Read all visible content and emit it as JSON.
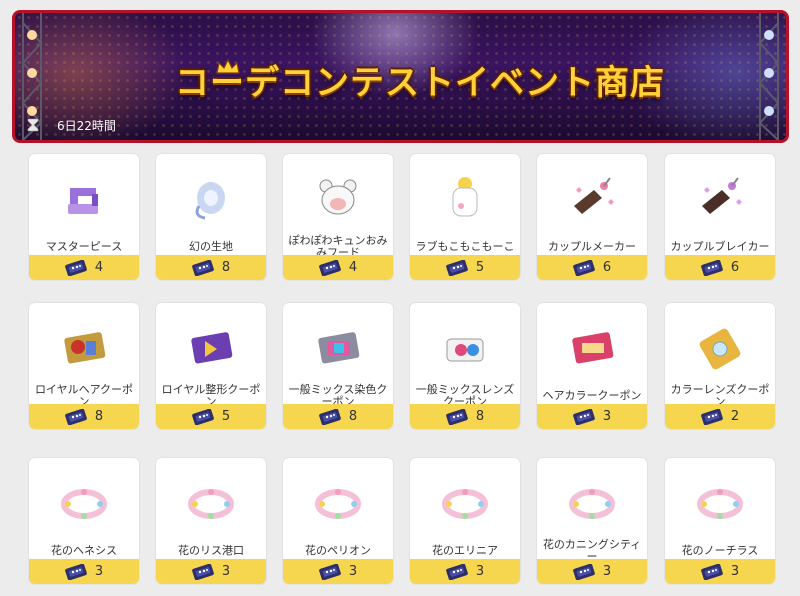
{
  "banner": {
    "title": "コーデコンテストイベント商店",
    "timer": "6日22時間",
    "colors": {
      "border": "#b5122a",
      "title": "#ffd23b"
    }
  },
  "currency_icon": "ticket-icon",
  "price_bar_color": "#f6d54f",
  "items": [
    {
      "name": "マスターピース",
      "price": "4",
      "icon": "sewing-machine-icon"
    },
    {
      "name": "幻の生地",
      "price": "8",
      "icon": "fabric-roll-icon"
    },
    {
      "name": "ぽわぽわキュンおみみフード",
      "price": "4",
      "icon": "bear-hood-icon"
    },
    {
      "name": "ラブもこもこもーこ",
      "price": "5",
      "icon": "sheep-outfit-icon"
    },
    {
      "name": "カップルメーカー",
      "price": "6",
      "icon": "couple-maker-icon"
    },
    {
      "name": "カップルブレイカー",
      "price": "6",
      "icon": "couple-breaker-icon"
    },
    {
      "name": "ロイヤルヘアクーポン",
      "price": "8",
      "icon": "royal-hair-coupon-icon"
    },
    {
      "name": "ロイヤル整形クーポン",
      "price": "5",
      "icon": "royal-face-coupon-icon"
    },
    {
      "name": "一般ミックス染色クーポン",
      "price": "8",
      "icon": "mix-dye-coupon-icon"
    },
    {
      "name": "一般ミックスレンズクーポン",
      "price": "8",
      "icon": "mix-lens-coupon-icon"
    },
    {
      "name": "ヘアカラークーポン",
      "price": "3",
      "icon": "hair-color-coupon-icon"
    },
    {
      "name": "カラーレンズクーポン",
      "price": "2",
      "icon": "color-lens-coupon-icon"
    },
    {
      "name": "花のヘネシス",
      "price": "3",
      "icon": "flower-wreath-icon"
    },
    {
      "name": "花のリス港口",
      "price": "3",
      "icon": "flower-wreath-icon"
    },
    {
      "name": "花のペリオン",
      "price": "3",
      "icon": "flower-wreath-icon"
    },
    {
      "name": "花のエリニア",
      "price": "3",
      "icon": "flower-wreath-icon"
    },
    {
      "name": "花のカニングシティー",
      "price": "3",
      "icon": "flower-wreath-icon"
    },
    {
      "name": "花のノーチラス",
      "price": "3",
      "icon": "flower-wreath-icon"
    }
  ]
}
